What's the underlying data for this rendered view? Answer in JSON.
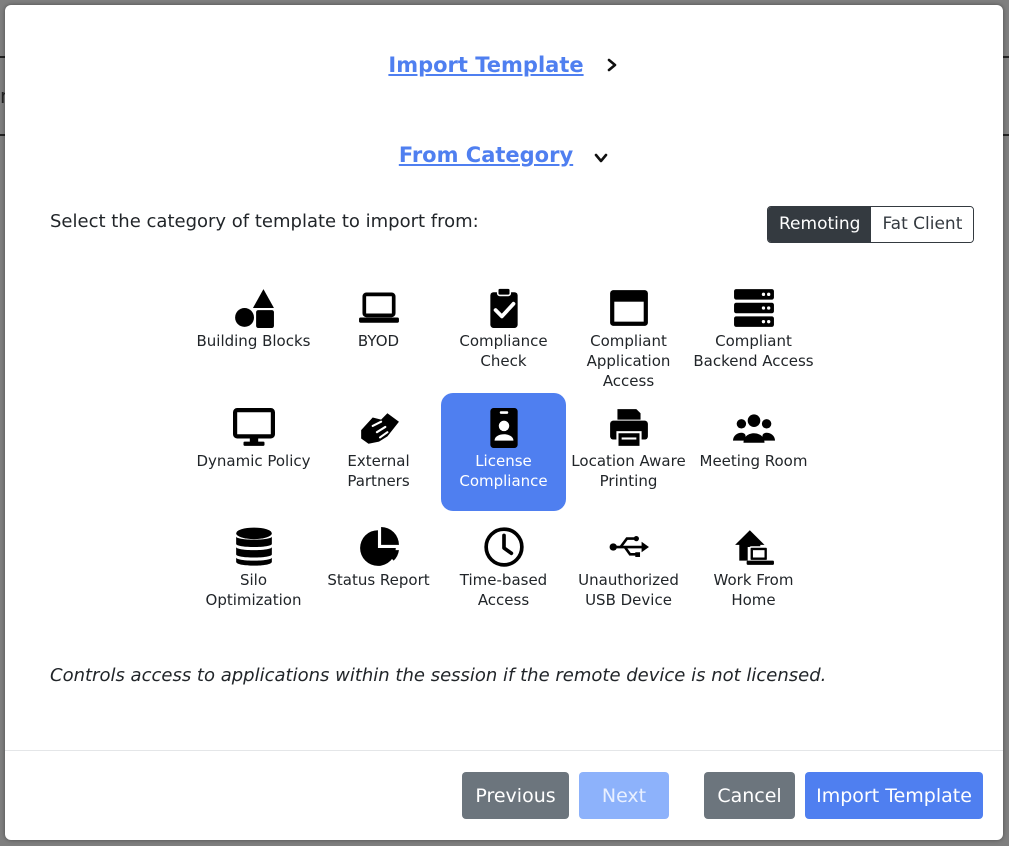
{
  "background": {
    "partial_glyph": "n"
  },
  "header": {
    "import_template_label": "Import Template",
    "from_category_label": "From Category"
  },
  "prompt_text": "Select the category of template to import from:",
  "mode_toggle": {
    "options": [
      "Remoting",
      "Fat Client"
    ],
    "selected": "Remoting"
  },
  "categories": [
    {
      "label_lines": [
        "Building Blocks"
      ],
      "icon": "shapes-icon"
    },
    {
      "label_lines": [
        "BYOD"
      ],
      "icon": "laptop-icon"
    },
    {
      "label_lines": [
        "Compliance",
        "Check"
      ],
      "icon": "clipboard-check-icon"
    },
    {
      "label_lines": [
        "Compliant",
        "Application",
        "Access"
      ],
      "icon": "window-icon"
    },
    {
      "label_lines": [
        "Compliant",
        "Backend Access"
      ],
      "icon": "server-icon"
    },
    {
      "label_lines": [
        "Dynamic Policy"
      ],
      "icon": "desktop-icon"
    },
    {
      "label_lines": [
        "External Partners"
      ],
      "icon": "handshake-icon"
    },
    {
      "label_lines": [
        "License",
        "Compliance"
      ],
      "icon": "id-badge-icon"
    },
    {
      "label_lines": [
        "Location Aware",
        "Printing"
      ],
      "icon": "printer-icon"
    },
    {
      "label_lines": [
        "Meeting Room"
      ],
      "icon": "users-icon"
    },
    {
      "label_lines": [
        "Silo",
        "Optimization"
      ],
      "icon": "database-icon"
    },
    {
      "label_lines": [
        "Status Report"
      ],
      "icon": "pie-chart-icon"
    },
    {
      "label_lines": [
        "Time-based",
        "Access"
      ],
      "icon": "clock-icon"
    },
    {
      "label_lines": [
        "Unauthorized",
        "USB Device"
      ],
      "icon": "usb-icon"
    },
    {
      "label_lines": [
        "Work From",
        "Home"
      ],
      "icon": "house-laptop-icon"
    }
  ],
  "selected_category": "License Compliance",
  "description": "Controls access to applications within the session if the remote device is not licensed.",
  "footer": {
    "previous_label": "Previous",
    "next_label": "Next",
    "cancel_label": "Cancel",
    "import_label": "Import Template"
  },
  "colors": {
    "accent": "#4f7ff0",
    "accent_disabled": "#8db2fb",
    "secondary": "#6c757d",
    "dark": "#343a40"
  }
}
